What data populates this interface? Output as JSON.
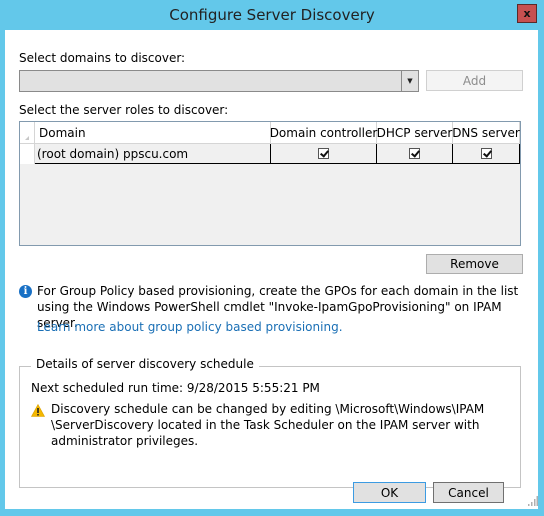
{
  "window": {
    "title": "Configure Server Discovery",
    "close_label": "x"
  },
  "domains": {
    "label": "Select domains to discover:",
    "selected_value": "",
    "add_label": "Add"
  },
  "roles": {
    "label": "Select the server roles to discover:",
    "columns": [
      "Domain",
      "Domain controller",
      "DHCP server",
      "DNS server"
    ],
    "rows": [
      {
        "domain": "(root domain) ppscu.com",
        "domain_controller": true,
        "dhcp_server": true,
        "dns_server": true
      }
    ],
    "remove_label": "Remove"
  },
  "info": {
    "icon": "info-icon",
    "text": "For Group Policy based provisioning, create the GPOs for each domain in the list using the Windows PowerShell cmdlet \"Invoke-IpamGpoProvisioning\" on IPAM server.",
    "link": "Learn more about group policy based provisioning."
  },
  "schedule": {
    "group_title": "Details of server discovery schedule",
    "next_run": "Next scheduled run time: 9/28/2015 5:55:21 PM",
    "warning_icon": "warning-icon",
    "warning_text": "Discovery schedule can be changed by editing \\Microsoft\\Windows\\IPAM \\ServerDiscovery located in the Task Scheduler on the IPAM server with administrator privileges."
  },
  "footer": {
    "ok_label": "OK",
    "cancel_label": "Cancel"
  },
  "colors": {
    "frame": "#63c8ea",
    "close": "#c75050",
    "link": "#1a6fb5",
    "info": "#1870c5",
    "warning": "#f5b800"
  }
}
